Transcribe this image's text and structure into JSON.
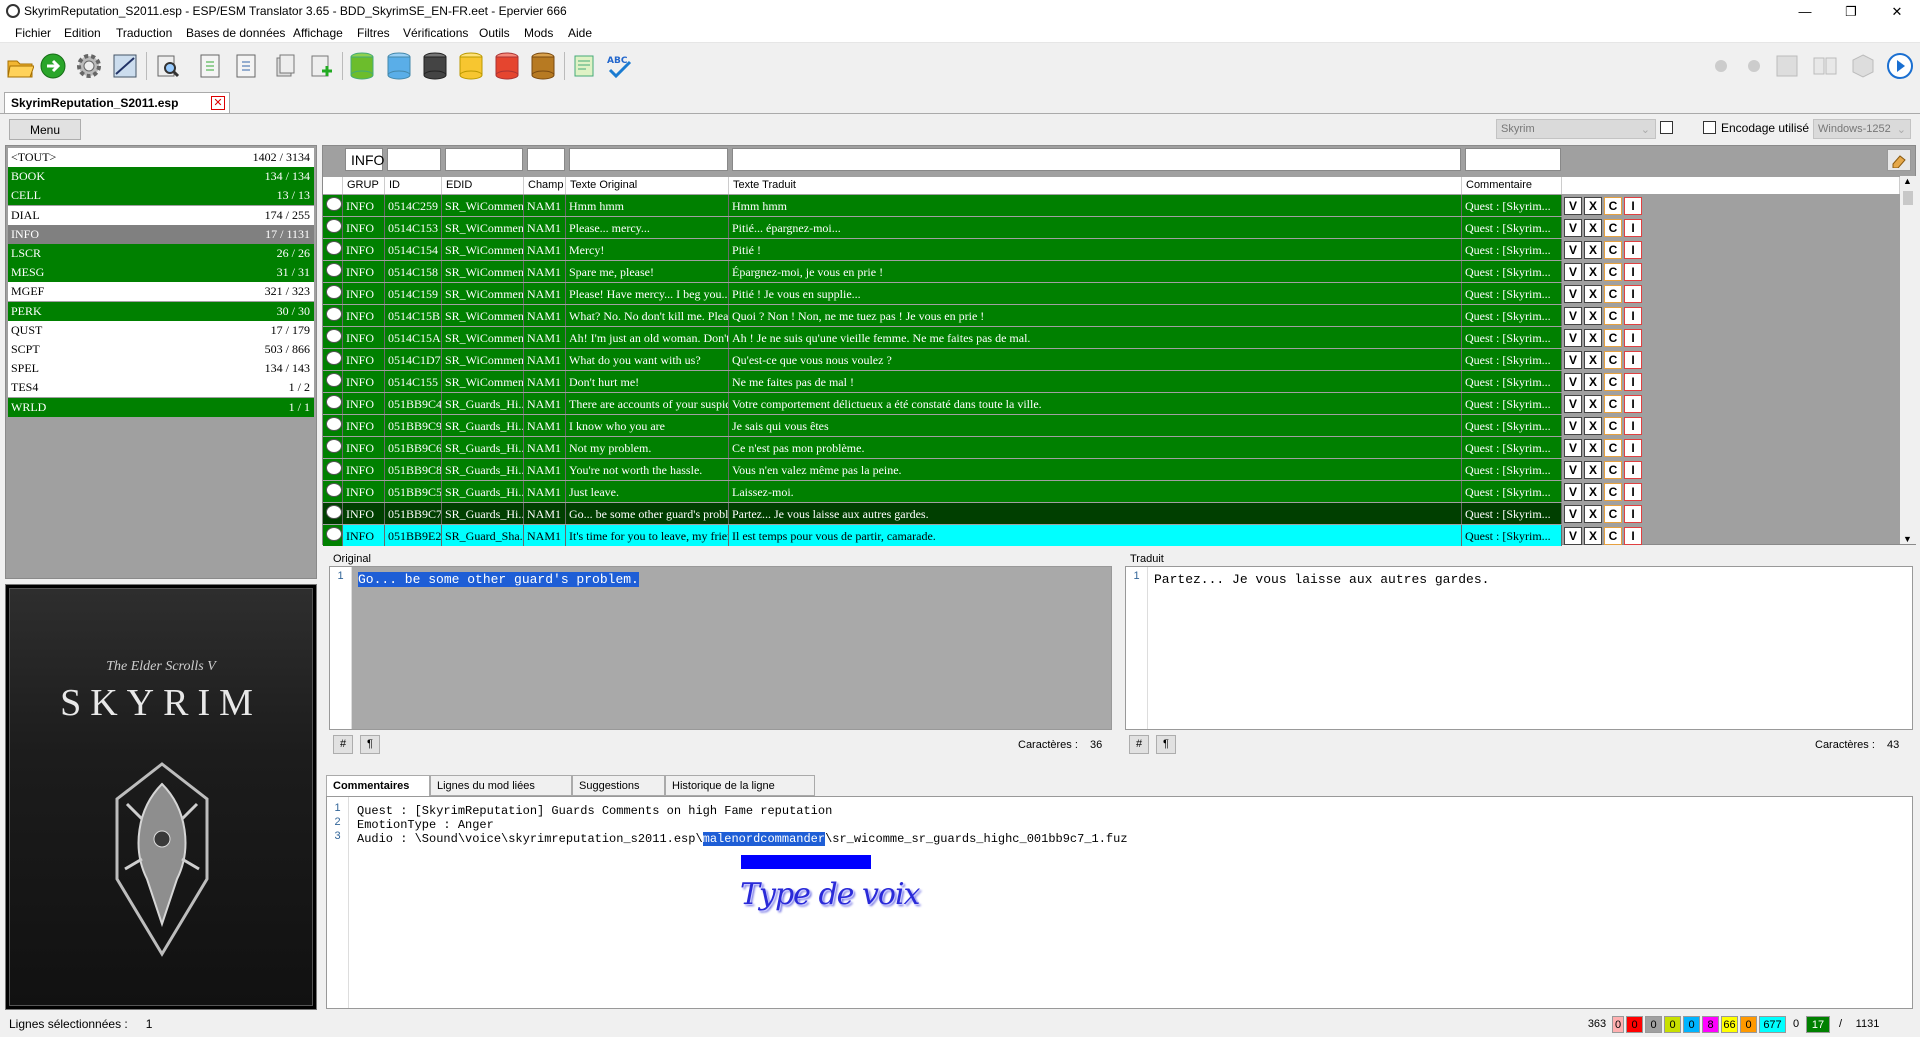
{
  "window": {
    "title": "SkyrimReputation_S2011.esp - ESP/ESM Translator 3.65 - BDD_SkyrimSE_EN-FR.eet - Epervier 666"
  },
  "menu": [
    "Fichier",
    "Edition",
    "Traduction",
    "Bases de données",
    "Affichage",
    "Filtres",
    "Vérifications",
    "Outils",
    "Mods",
    "Aide"
  ],
  "document_tab": {
    "label": "SkyrimReputation_S2011.esp"
  },
  "options": {
    "menu_button": "Menu",
    "game": "Skyrim",
    "encoding_label": "Encodage utilisé",
    "encoding": "Windows-1252"
  },
  "categories": [
    {
      "name": "<TOUT>",
      "count": "1402 / 3134",
      "state": "w"
    },
    {
      "name": "BOOK",
      "count": "134 / 134",
      "state": "g"
    },
    {
      "name": "CELL",
      "count": "13 / 13",
      "state": "g"
    },
    {
      "name": "DIAL",
      "count": "174 / 255",
      "state": "w"
    },
    {
      "name": "INFO",
      "count": "17 / 1131",
      "state": "s"
    },
    {
      "name": "LSCR",
      "count": "26 / 26",
      "state": "g"
    },
    {
      "name": "MESG",
      "count": "31 / 31",
      "state": "g"
    },
    {
      "name": "MGEF",
      "count": "321 / 323",
      "state": "w"
    },
    {
      "name": "PERK",
      "count": "30 / 30",
      "state": "g"
    },
    {
      "name": "QUST",
      "count": "17 / 179",
      "state": "w"
    },
    {
      "name": "SCPT",
      "count": "503 / 866",
      "state": "w"
    },
    {
      "name": "SPEL",
      "count": "134 / 143",
      "state": "w"
    },
    {
      "name": "TES4",
      "count": "1 / 2",
      "state": "w"
    },
    {
      "name": "WRLD",
      "count": "1 / 1",
      "state": "g"
    }
  ],
  "cover": {
    "subtitle": "The Elder Scrolls V",
    "title": "SKYRIM"
  },
  "filter": {
    "grup": "INFO"
  },
  "columns": [
    "GRUP",
    "ID",
    "EDID",
    "Champ",
    "Texte Original",
    "Texte Traduit",
    "Commentaire"
  ],
  "rows": [
    {
      "grup": "INFO",
      "id": "0514C259",
      "edid": "SR_WiCommen...",
      "champ": "NAM1",
      "orig": "Hmm hmm",
      "trad": "Hmm hmm",
      "comment": "Quest : [Skyrim...",
      "state": "g"
    },
    {
      "grup": "INFO",
      "id": "0514C153",
      "edid": "SR_WiCommen...",
      "champ": "NAM1",
      "orig": "Please... mercy...",
      "trad": "Pitié... épargnez-moi...",
      "comment": "Quest : [Skyrim...",
      "state": "g"
    },
    {
      "grup": "INFO",
      "id": "0514C154",
      "edid": "SR_WiCommen...",
      "champ": "NAM1",
      "orig": "Mercy!",
      "trad": "Pitié !",
      "comment": "Quest : [Skyrim...",
      "state": "g"
    },
    {
      "grup": "INFO",
      "id": "0514C158",
      "edid": "SR_WiCommen...",
      "champ": "NAM1",
      "orig": "Spare me, please!",
      "trad": "Épargnez-moi, je vous en prie !",
      "comment": "Quest : [Skyrim...",
      "state": "g"
    },
    {
      "grup": "INFO",
      "id": "0514C159",
      "edid": "SR_WiCommen...",
      "champ": "NAM1",
      "orig": "Please! Have mercy... I beg you...",
      "trad": "Pitié ! Je vous en supplie...",
      "comment": "Quest : [Skyrim...",
      "state": "g"
    },
    {
      "grup": "INFO",
      "id": "0514C15B",
      "edid": "SR_WiCommen...",
      "champ": "NAM1",
      "orig": "What? No. No don't kill me. Please!",
      "trad": "Quoi ? Non ! Non, ne me tuez pas ! Je vous en prie !",
      "comment": "Quest : [Skyrim...",
      "state": "g"
    },
    {
      "grup": "INFO",
      "id": "0514C15A",
      "edid": "SR_WiCommen...",
      "champ": "NAM1",
      "orig": "Ah! I'm just an old woman. Don't ...",
      "trad": "Ah ! Je ne suis qu'une vieille femme. Ne me faites pas de mal.",
      "comment": "Quest : [Skyrim...",
      "state": "g"
    },
    {
      "grup": "INFO",
      "id": "0514C1D7",
      "edid": "SR_WiCommen...",
      "champ": "NAM1",
      "orig": "What do you want with us?",
      "trad": "Qu'est-ce que vous nous voulez ?",
      "comment": "Quest : [Skyrim...",
      "state": "g"
    },
    {
      "grup": "INFO",
      "id": "0514C155",
      "edid": "SR_WiCommen...",
      "champ": "NAM1",
      "orig": "Don't hurt me!",
      "trad": "Ne me faites pas de mal !",
      "comment": "Quest : [Skyrim...",
      "state": "g"
    },
    {
      "grup": "INFO",
      "id": "051BB9C4",
      "edid": "SR_Guards_Hi...",
      "champ": "NAM1",
      "orig": "There are accounts of your suspic...",
      "trad": "Votre comportement délictueux a été constaté dans toute la ville.",
      "comment": "Quest : [Skyrim...",
      "state": "g"
    },
    {
      "grup": "INFO",
      "id": "051BB9C9",
      "edid": "SR_Guards_Hi...",
      "champ": "NAM1",
      "orig": "I know who you are",
      "trad": "Je sais qui vous êtes",
      "comment": "Quest : [Skyrim...",
      "state": "g"
    },
    {
      "grup": "INFO",
      "id": "051BB9C6",
      "edid": "SR_Guards_Hi...",
      "champ": "NAM1",
      "orig": "Not my problem.",
      "trad": "Ce n'est pas mon problème.",
      "comment": "Quest : [Skyrim...",
      "state": "g"
    },
    {
      "grup": "INFO",
      "id": "051BB9C8",
      "edid": "SR_Guards_Hi...",
      "champ": "NAM1",
      "orig": "You're not worth the hassle.",
      "trad": "Vous n'en valez même pas la peine.",
      "comment": "Quest : [Skyrim...",
      "state": "g"
    },
    {
      "grup": "INFO",
      "id": "051BB9C5",
      "edid": "SR_Guards_Hi...",
      "champ": "NAM1",
      "orig": "Just leave.",
      "trad": "Laissez-moi.",
      "comment": "Quest : [Skyrim...",
      "state": "g"
    },
    {
      "grup": "INFO",
      "id": "051BB9C7",
      "edid": "SR_Guards_Hi...",
      "champ": "NAM1",
      "orig": "Go... be some other guard's proble...",
      "trad": "Partez... Je vous laisse aux autres gardes.",
      "comment": "Quest : [Skyrim...",
      "state": "d"
    },
    {
      "grup": "INFO",
      "id": "051BB9E2",
      "edid": "SR_Guard_Sha...",
      "champ": "NAM1",
      "orig": "It's time for you to leave, my friend.",
      "trad": "Il est temps pour vous de partir, camarade.",
      "comment": "Quest : [Skyrim...",
      "state": "c"
    }
  ],
  "row_buttons": {
    "v": "V",
    "x": "X",
    "c": "C",
    "i": "I"
  },
  "original_pane": {
    "label": "Original",
    "line_no": "1",
    "text": "Go... be some other guard's problem.",
    "chars_label": "Caractères :",
    "chars": "36"
  },
  "translated_pane": {
    "label": "Traduit",
    "line_no": "1",
    "text": "Partez... Je vous laisse aux autres gardes.",
    "chars_label": "Caractères :",
    "chars": "43"
  },
  "pane_buttons": {
    "hash": "#",
    "pilcrow": "¶"
  },
  "bottom_tabs": [
    "Commentaires",
    "Lignes du mod liées",
    "Suggestions",
    "Historique de la ligne"
  ],
  "comments": {
    "line_numbers": [
      "1",
      "2",
      "3"
    ],
    "line1": "Quest : [SkyrimReputation] Guards Comments on high Fame reputation",
    "line2": "EmotionType : Anger",
    "line3_pre": "Audio : \\Sound\\voice\\skyrimreputation_s2011.esp\\",
    "line3_hl": "malenordcommander",
    "line3_post": "\\sr_wicomme_sr_guards_highc_001bb9c7_1.fuz",
    "annotation": "Type de voix"
  },
  "status": {
    "label": "Lignes sélectionnées :",
    "value": "1"
  },
  "counters": [
    {
      "value": "363",
      "bg": "#f0f0f0",
      "fg": "#000"
    },
    {
      "value": "0",
      "bg": "#ffb0b0",
      "fg": "#000"
    },
    {
      "value": "0",
      "bg": "#ff0000",
      "fg": "#000"
    },
    {
      "value": "0",
      "bg": "#a0a0a0",
      "fg": "#000"
    },
    {
      "value": "0",
      "bg": "#c8e000",
      "fg": "#000"
    },
    {
      "value": "0",
      "bg": "#00b4ff",
      "fg": "#000"
    },
    {
      "value": "8",
      "bg": "#ff00ff",
      "fg": "#000"
    },
    {
      "value": "66",
      "bg": "#ffff00",
      "fg": "#000"
    },
    {
      "value": "0",
      "bg": "#ff9900",
      "fg": "#000"
    },
    {
      "value": "677",
      "bg": "#00ffff",
      "fg": "#000"
    },
    {
      "value": "0",
      "bg": "#f0f0f0",
      "fg": "#000"
    },
    {
      "value": "17",
      "bg": "#008000",
      "fg": "#fff"
    },
    {
      "value": "/",
      "bg": "#f0f0f0",
      "fg": "#000"
    },
    {
      "value": "1131",
      "bg": "#f0f0f0",
      "fg": "#000"
    }
  ]
}
